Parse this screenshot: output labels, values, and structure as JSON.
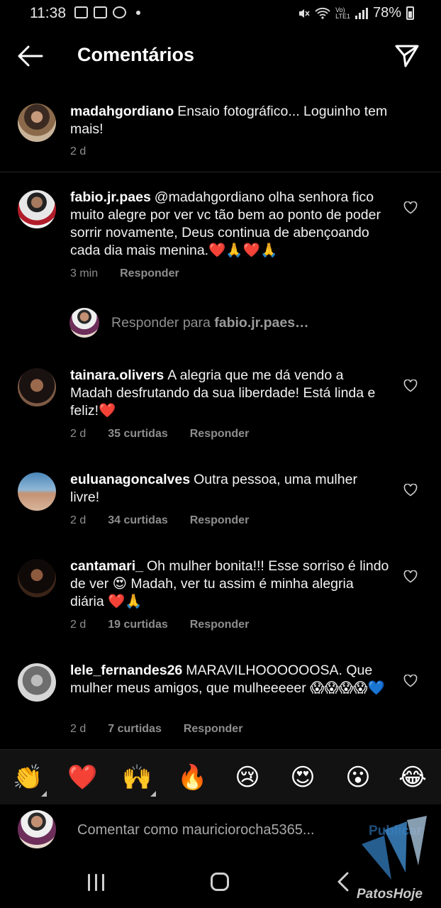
{
  "status_bar": {
    "time": "11:38",
    "battery": "78%"
  },
  "header": {
    "title": "Comentários"
  },
  "caption": {
    "username": "madahgordiano",
    "text": "Ensaio fotográfico... Loguinho tem mais!",
    "time": "2 d"
  },
  "comments": [
    {
      "username": "fabio.jr.paes",
      "text": "@madahgordiano  olha senhora fico muito alegre por ver vc tão bem ao ponto de poder sorrir novamente,  Deus continua de abençoando cada dia mais menina.❤️🙏❤️🙏",
      "time": "3 min",
      "likes": "",
      "reply": "Responder"
    },
    {
      "username": "tainara.olivers",
      "text": "A alegria que me dá vendo a Madah desfrutando da sua liberdade! Está linda e feliz!❤️",
      "time": "2 d",
      "likes": "35 curtidas",
      "reply": "Responder"
    },
    {
      "username": "euluanagoncalves",
      "text": "Outra pessoa, uma mulher livre!",
      "time": "2 d",
      "likes": "34 curtidas",
      "reply": "Responder"
    },
    {
      "username": "cantamari_",
      "text": "Oh mulher bonita!!! Esse sorriso é lindo de ver 😍 Madah, ver tu assim é minha alegria diária ❤️🙏",
      "time": "2 d",
      "likes": "19 curtidas",
      "reply": "Responder"
    },
    {
      "username": "lele_fernandes26",
      "text": "MARAVILHOOOOOOSA. Que mulher meus amigos, que mulheeeeer 😱😱😱😱💙",
      "time": "2 d",
      "likes": "7 curtidas",
      "reply": "Responder"
    }
  ],
  "reply_prompt": {
    "prefix": "Responder para ",
    "username": "fabio.jr.paes…"
  },
  "emoji_bar": [
    "👏",
    "❤️",
    "🙌",
    "🔥",
    "😢",
    "😍",
    "😮",
    "😂"
  ],
  "comment_box": {
    "placeholder": "Comentar como mauriciorocha5365...",
    "publish": "Publicar"
  },
  "watermark": {
    "text": "PatosHoje"
  },
  "colors": {
    "background": "#000000",
    "secondary_text": "#8e8e8e",
    "publish": "#1f4e7a"
  },
  "icons": [
    "back-arrow-icon",
    "send-direct-icon",
    "heart-outline-icon",
    "recent-apps-icon",
    "home-icon",
    "nav-back-icon"
  ]
}
